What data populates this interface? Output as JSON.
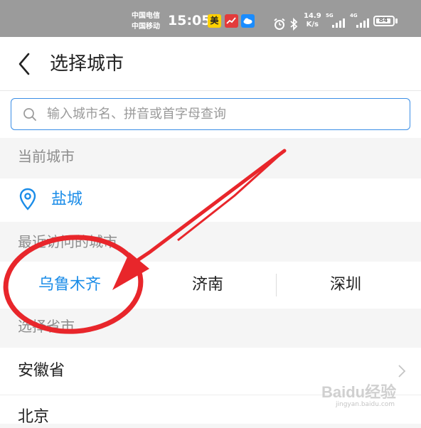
{
  "status_bar": {
    "carrier_1": "中国电信",
    "carrier_2": "中国移动",
    "time": "15:05",
    "app_icon_1": "美",
    "network_speed_value": "14.9",
    "network_speed_unit": "K/s",
    "signal_1_tag": "5G",
    "signal_2_tag": "4G",
    "battery": "84",
    "icons": [
      "meituan-icon",
      "chart-icon",
      "cloud-icon",
      "alarm-icon",
      "bluetooth-icon",
      "signal-icon",
      "battery-icon"
    ]
  },
  "header": {
    "title": "选择城市",
    "back_icon": "chevron-left-icon"
  },
  "search": {
    "placeholder": "输入城市名、拼音或首字母查询",
    "icon": "search-icon"
  },
  "current_city": {
    "section_title": "当前城市",
    "name": "盐城",
    "icon": "location-pin-icon"
  },
  "recent": {
    "section_title": "最近访问的城市",
    "cities": [
      "乌鲁木齐",
      "济南",
      "深圳"
    ]
  },
  "provinces": {
    "section_title": "选择省市",
    "items": [
      "安徽省",
      "北京"
    ]
  },
  "watermark": {
    "brand": "Baidu经验",
    "url": "jingyan.baidu.com"
  },
  "colors": {
    "accent": "#1a8ce8",
    "annotation": "#e8262b",
    "status_bar": "#9b9b9b"
  }
}
